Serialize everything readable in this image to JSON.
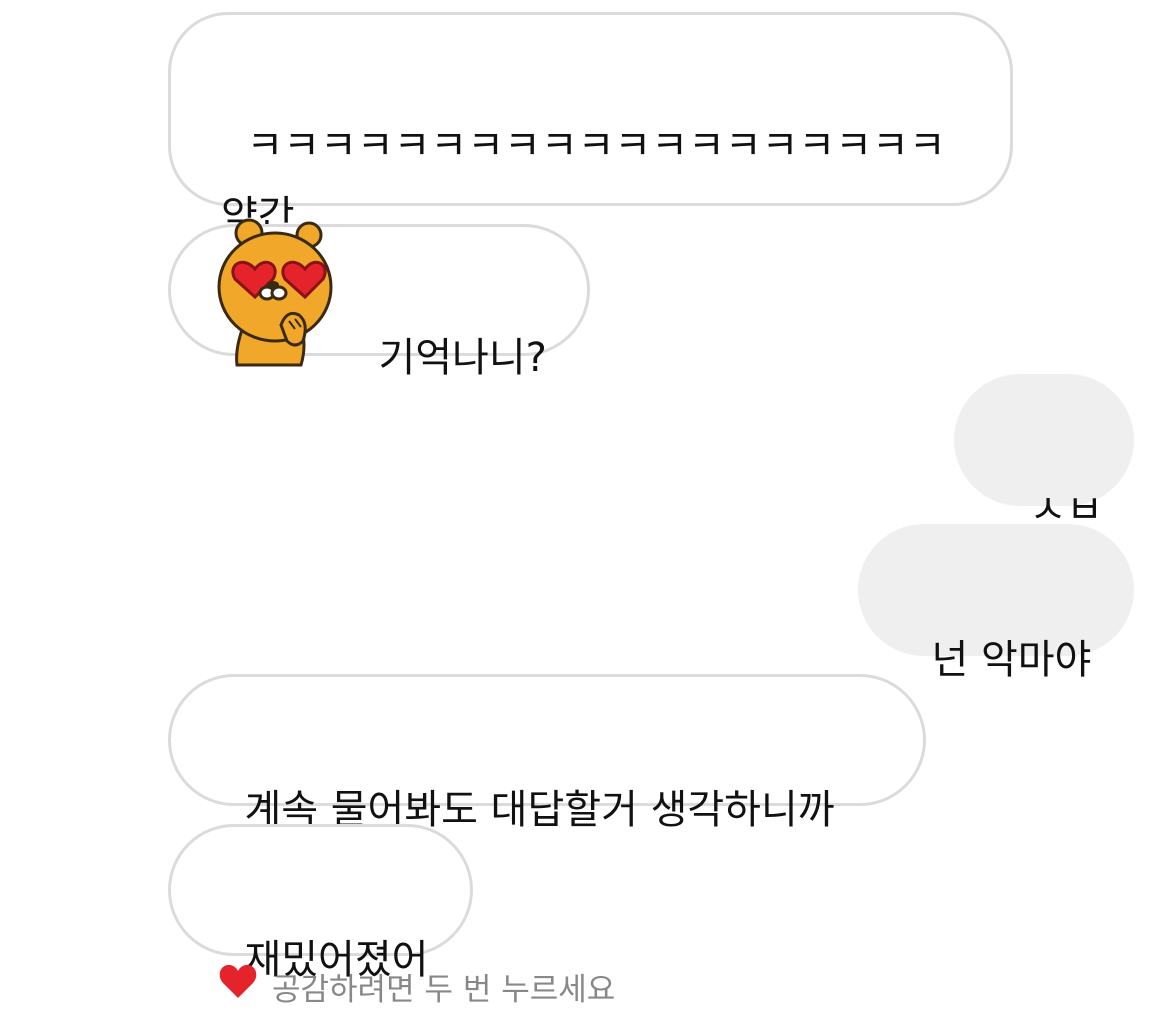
{
  "messages": [
    {
      "id": "m1",
      "sender": "other",
      "text": "ㅋㅋㅋㅋㅋㅋㅋㅋㅋㅋㅋㅋㅋㅋㅋㅋㅋㅋㅋ 약간"
    },
    {
      "id": "m2",
      "sender": "other",
      "text": "기억나니?",
      "emoji": "ryan-heart-eyes-icon"
    },
    {
      "id": "m3",
      "sender": "me",
      "text": "ㅅㅂ"
    },
    {
      "id": "m4",
      "sender": "me",
      "text": "넌 악마야"
    },
    {
      "id": "m5",
      "sender": "other",
      "text": "계속 물어봐도 대답할거 생각하니까"
    },
    {
      "id": "m6",
      "sender": "other",
      "text": "재밌어졌어"
    }
  ],
  "reaction_hint": {
    "icon": "heart-icon",
    "text": "공감하려면 두 번 누르세요"
  },
  "colors": {
    "incoming_bg": "#ffffff",
    "incoming_border": "#dbdbdb",
    "outgoing_bg": "#efeff0",
    "text": "#111111",
    "hint_text": "#888888",
    "heart": "#e5232b"
  }
}
